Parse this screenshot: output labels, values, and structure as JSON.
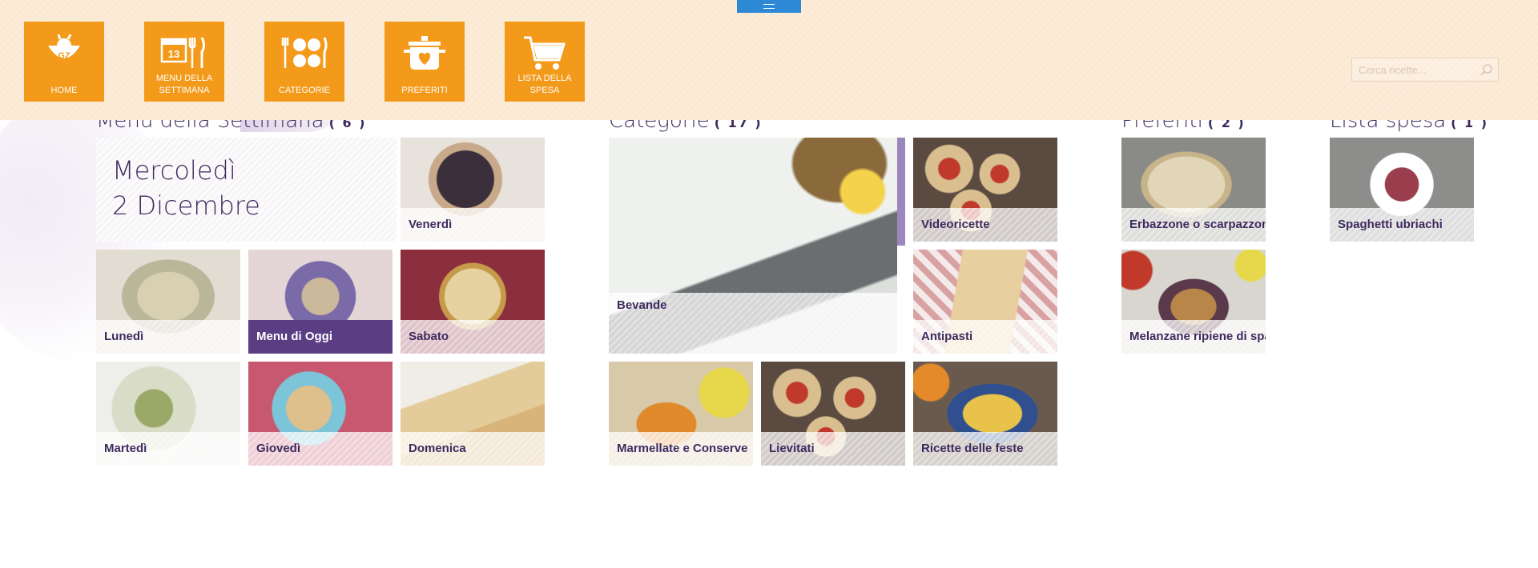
{
  "nav": {
    "buttons": [
      {
        "label": "HOME",
        "icon": "home-logo-icon"
      },
      {
        "label": "MENU DELLA SETTIMANA",
        "icon": "calendar-cutlery-icon"
      },
      {
        "label": "CATEGORIE",
        "icon": "categories-icon"
      },
      {
        "label": "PREFERITI",
        "icon": "pot-heart-icon"
      },
      {
        "label": "LISTA DELLA SPESA",
        "icon": "shopping-cart-icon"
      }
    ],
    "calendar_number": "13"
  },
  "search": {
    "placeholder": "Cerca ricette..."
  },
  "sections": {
    "menu": {
      "title": "Menu della Settimana",
      "count": "( 6 )"
    },
    "categories": {
      "title": "Categorie",
      "count": "( 17 )"
    },
    "favorites": {
      "title": "Preferiti",
      "count": "( 2 )"
    },
    "shopping": {
      "title": "Lista spesa",
      "count": "( 1 )"
    }
  },
  "today": {
    "day": "Mercoledì",
    "date": "2 Dicembre"
  },
  "menu_tiles": {
    "venerdi": "Venerdì",
    "lunedi": "Lunedì",
    "oggi": "Menu di Oggi",
    "sabato": "Sabato",
    "martedi": "Martedì",
    "giovedi": "Giovedì",
    "domenica": "Domenica"
  },
  "category_tiles": {
    "bevande": "Bevande",
    "videoricette": "Videoricette",
    "antipasti": "Antipasti",
    "marmellate": "Marmellate e Conserve",
    "lievitati": "Lievitati",
    "feste": "Ricette delle feste"
  },
  "favorite_tiles": {
    "erbazzone": "Erbazzone o scarpazzone",
    "melanzane": "Melanzane ripiene di spaghetti"
  },
  "shopping_tiles": {
    "spaghetti": "Spaghetti ubriachi"
  },
  "colors": {
    "nav_orange": "#f39a1b",
    "title_purple": "#3e2a5e",
    "active_purple": "#5b3d84",
    "appbar_bg": "#fbe9d3",
    "handle_blue": "#2d89d6"
  }
}
